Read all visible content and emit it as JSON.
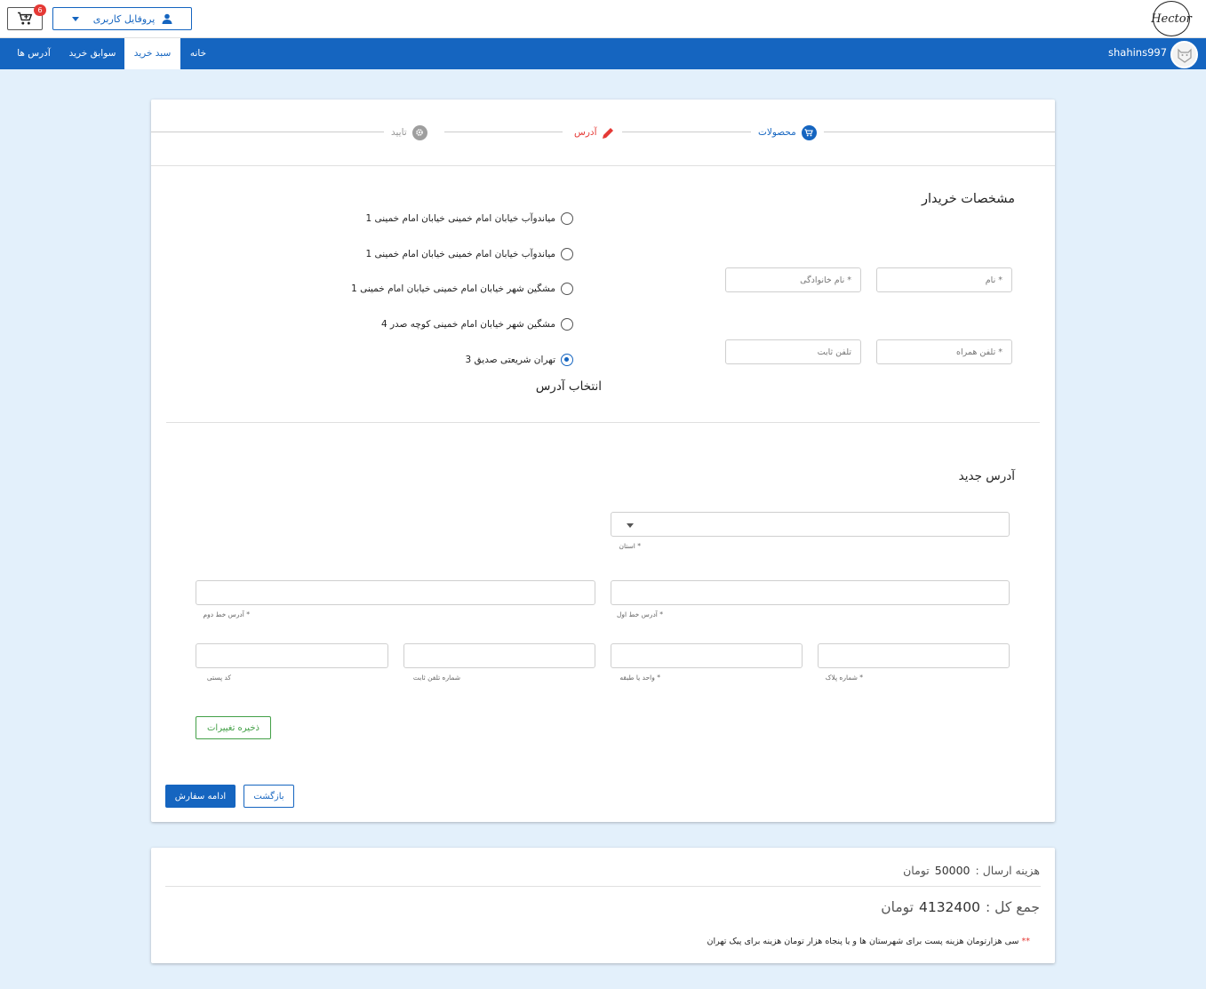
{
  "header": {
    "cart_count": "6",
    "profile_label": "پروفایل کاربری",
    "logo_text": "Hector"
  },
  "nav": {
    "items": [
      {
        "label": "آدرس ها"
      },
      {
        "label": "سوابق خرید"
      },
      {
        "label": "سبد خرید"
      },
      {
        "label": "خانه"
      }
    ],
    "active": "سبد خرید",
    "username": "shahins997"
  },
  "stepper": {
    "steps": [
      {
        "label": "محصولات",
        "state": "done"
      },
      {
        "label": "آدرس",
        "state": "active"
      },
      {
        "label": "تایید",
        "state": "pending"
      }
    ]
  },
  "buyer": {
    "title": "مشخصات خریدار",
    "first_name_placeholder": "* نام",
    "last_name_placeholder": "* نام خانوادگی",
    "mobile_placeholder": "* تلفن همراه",
    "phone_placeholder": "تلفن ثابت"
  },
  "address_select": {
    "title": "انتخاب آدرس",
    "options": [
      {
        "label": "میاندوآب خیابان امام خمینی خیابان امام خمینی 1",
        "checked": false
      },
      {
        "label": "میاندوآب خیابان امام خمینی خیابان امام خمینی 1",
        "checked": false
      },
      {
        "label": "مشگین شهر خیابان امام خمینی خیابان امام خمینی 1",
        "checked": false
      },
      {
        "label": "مشگین شهر خیابان امام خمینی کوچه صدر 4",
        "checked": false
      },
      {
        "label": "تهران شریعتی صدیق 3",
        "checked": true
      }
    ]
  },
  "new_address": {
    "title": "آدرس جدید",
    "province_label": "* استان",
    "line1_label": "* آدرس خط اول",
    "line2_label": "* آدرس خط دوم",
    "plate_label": "* شماره پلاک",
    "unit_label": "* واحد یا طبقه",
    "phone_label": "شماره تلفن ثابت",
    "postal_label": "کد پستی",
    "save_label": "ذخیره تغییرات"
  },
  "actions": {
    "back_label": "بازگشت",
    "continue_label": "ادامه سفارش"
  },
  "summary": {
    "shipping_label": "هزینه ارسال :",
    "shipping_value": "50000",
    "currency": "تومان",
    "total_label": "جمع کل :",
    "total_value": "4132400",
    "note_stars": "**",
    "note_text": "سی هزارتومان هزینه پست برای شهرستان ها و یا پنجاه هزار تومان هزینه برای پیک تهران"
  },
  "colors": {
    "primary": "#1565c0",
    "accent_red": "#e53935",
    "success": "#43a047",
    "background": "#e3f0fb"
  },
  "icons": [
    "cart-icon",
    "user-icon",
    "caret-down-icon",
    "cart-step-icon",
    "pencil-icon",
    "gear-icon"
  ]
}
